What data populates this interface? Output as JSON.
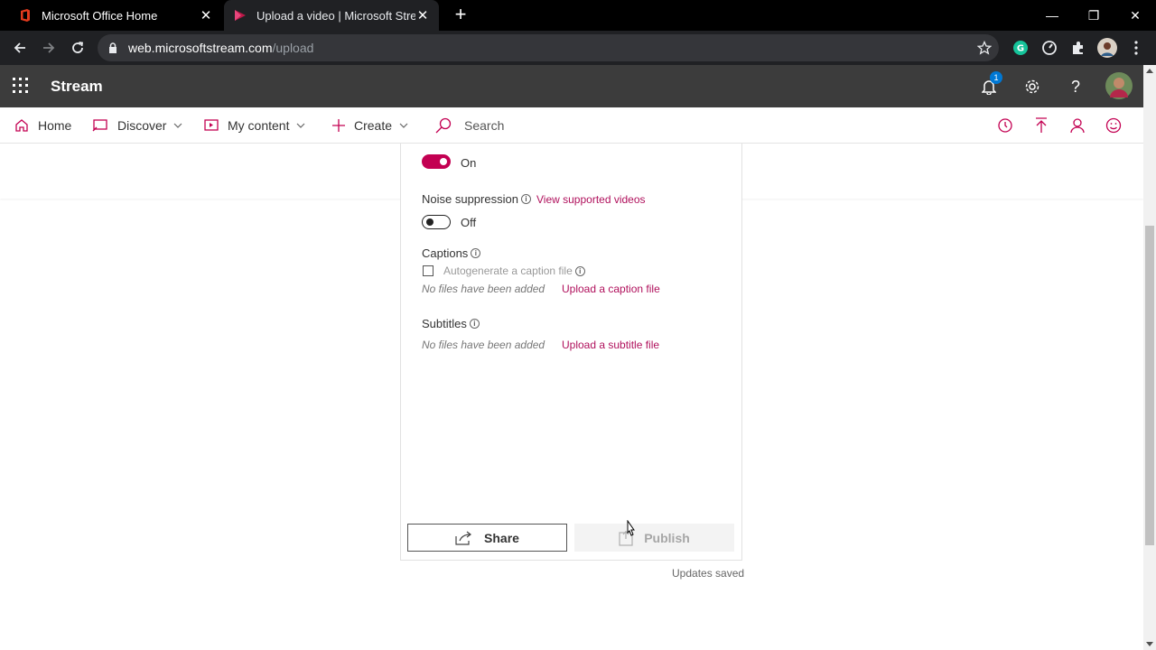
{
  "browser": {
    "tabs": [
      {
        "title": "Microsoft Office Home",
        "active": false,
        "icon": "office-icon"
      },
      {
        "title": "Upload a video | Microsoft Stream",
        "active": true,
        "icon": "stream-icon"
      }
    ],
    "url_host": "web.microsoftstream.com",
    "url_path": "/upload"
  },
  "app": {
    "name": "Stream",
    "notification_count": "1",
    "accent_color": "#c30052"
  },
  "nav": {
    "home": "Home",
    "discover": "Discover",
    "my_content": "My content",
    "create": "Create",
    "search_placeholder": "Search"
  },
  "form": {
    "top_toggle_state": "On",
    "noise_suppression_label": "Noise suppression",
    "view_supported_videos": "View supported videos",
    "noise_toggle_state": "Off",
    "captions_label": "Captions",
    "autogenerate_label": "Autogenerate a caption file",
    "captions_empty": "No files have been added",
    "upload_caption": "Upload a caption file",
    "subtitles_label": "Subtitles",
    "subtitles_empty": "No files have been added",
    "upload_subtitle": "Upload a subtitle file"
  },
  "actions": {
    "share": "Share",
    "publish": "Publish",
    "status": "Updates saved"
  }
}
